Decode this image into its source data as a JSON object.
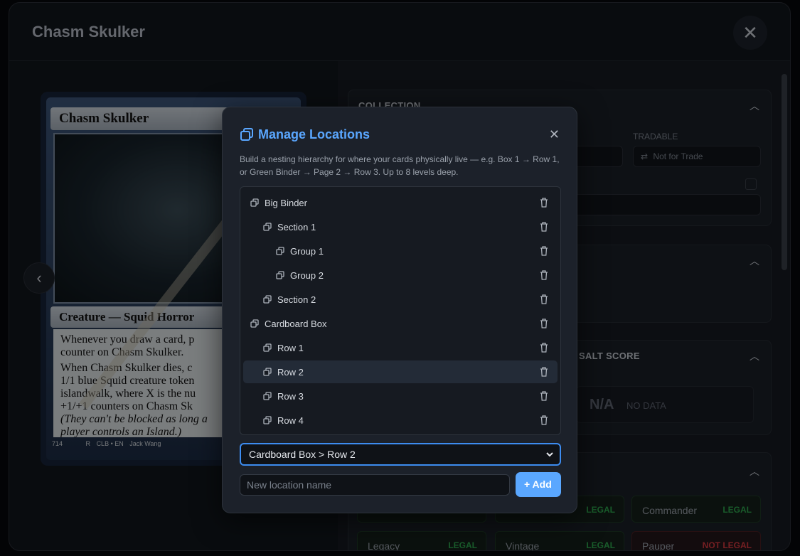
{
  "background": {
    "title": "Chasm Skulker",
    "card": {
      "name": "Chasm Skulker",
      "type_line": "Creature — Squid Horror",
      "rules_text": [
        "Whenever you draw a card, p",
        "counter on Chasm Skulker.",
        "When Chasm Skulker dies, c",
        "1/1 blue Squid creature token",
        "islandwalk, where X is the nu",
        "+1/+1 counters on Chasm Sk"
      ],
      "flavor_text": [
        "(They can't be blocked as long a",
        "player controls an Island.)"
      ],
      "collector": "714",
      "rarity": "R",
      "set_lang": "CLB • EN",
      "artist": "Jack Wang",
      "copyright": "™ & ©"
    },
    "sections": {
      "collection": "COLLECTION",
      "tradable_label": "TRADABLE",
      "tradable_value": "Not for Trade",
      "salt_score": "SALT SCORE",
      "salt_na": "N/A",
      "salt_nodata": "NO DATA"
    },
    "legalities": [
      {
        "format": "",
        "status": "LEGAL"
      },
      {
        "format": "Commander",
        "status": "LEGAL"
      },
      {
        "format": "Legacy",
        "status": "LEGAL"
      },
      {
        "format": "Vintage",
        "status": "LEGAL"
      },
      {
        "format": "Pauper",
        "status": "NOT LEGAL"
      }
    ]
  },
  "modal": {
    "title": "Manage Locations",
    "description": "Build a nesting hierarchy for where your cards physically live — e.g. Box 1 → Row 1, or Green Binder → Page 2 → Row 3. Up to 8 levels deep.",
    "locations": [
      {
        "label": "Big Binder",
        "depth": 0
      },
      {
        "label": "Section 1",
        "depth": 1
      },
      {
        "label": "Group 1",
        "depth": 2
      },
      {
        "label": "Group 2",
        "depth": 2
      },
      {
        "label": "Section 2",
        "depth": 1
      },
      {
        "label": "Cardboard Box",
        "depth": 0
      },
      {
        "label": "Row 1",
        "depth": 1
      },
      {
        "label": "Row 2",
        "depth": 1,
        "selected": true
      },
      {
        "label": "Row 3",
        "depth": 1
      },
      {
        "label": "Row 4",
        "depth": 1
      }
    ],
    "selected_path": "Cardboard Box > Row 2",
    "new_location_placeholder": "New location name",
    "add_label": "+ Add"
  },
  "colors": {
    "accent": "#5aa7ff",
    "legal": "#2fa84f",
    "not_legal": "#d8393f"
  },
  "icons": [
    "close-icon",
    "chevron-left-icon",
    "chevron-up-icon",
    "nested-squares-icon",
    "trash-icon",
    "chevron-down-icon",
    "swap-arrows-icon",
    "edit-icon"
  ]
}
